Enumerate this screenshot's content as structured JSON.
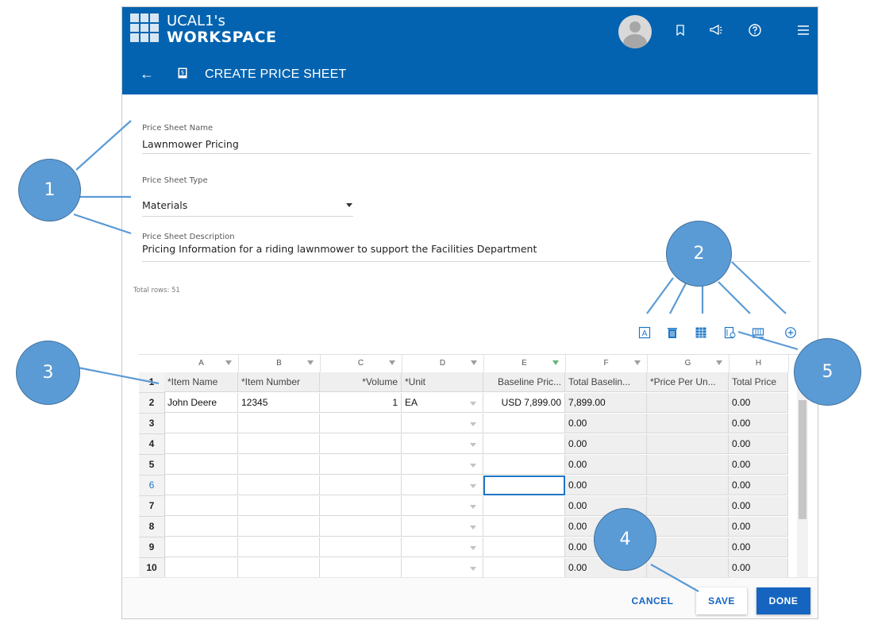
{
  "header": {
    "logo_line1": "UCAL1's",
    "logo_line2": "WORKSPACE",
    "page_title": "CREATE PRICE SHEET",
    "colors": {
      "header_blue": "#0363b0",
      "accent": "#1565c0",
      "callout": "#5b9bd5"
    },
    "icons": [
      "avatar",
      "bookmark-icon",
      "megaphone-icon",
      "help-icon",
      "menu-icon",
      "back-arrow-icon",
      "price-sheet-icon"
    ]
  },
  "form": {
    "name_label": "Price Sheet Name",
    "name_value": "Lawnmower Pricing",
    "type_label": "Price Sheet Type",
    "type_value": "Materials",
    "desc_label": "Price Sheet Description",
    "desc_value": "Pricing Information for a riding lawnmower to support the Facilities Department"
  },
  "total_rows": "Total rows: 51",
  "toolbar_icons": [
    "text-format-icon",
    "delete-icon",
    "columns-icon",
    "import-icon",
    "table-settings-icon",
    "add-icon"
  ],
  "grid": {
    "column_letters": [
      "A",
      "B",
      "C",
      "D",
      "E",
      "F",
      "G",
      "H"
    ],
    "header_row_number": "1",
    "headers": [
      "*Item Name",
      "*Item Number",
      "*Volume",
      "*Unit",
      "Baseline Pric...",
      "Total Baselin...",
      "*Price Per Un...",
      "Total Price"
    ],
    "rows": [
      {
        "num": "2",
        "cells": [
          "John Deere",
          "12345",
          "1",
          "EA",
          "USD 7,899.00",
          "7,899.00",
          "",
          "0.00"
        ]
      },
      {
        "num": "3",
        "cells": [
          "",
          "",
          "",
          "",
          "",
          "0.00",
          "",
          "0.00"
        ]
      },
      {
        "num": "4",
        "cells": [
          "",
          "",
          "",
          "",
          "",
          "0.00",
          "",
          "0.00"
        ]
      },
      {
        "num": "5",
        "cells": [
          "",
          "",
          "",
          "",
          "",
          "0.00",
          "",
          "0.00"
        ]
      },
      {
        "num": "6",
        "cells": [
          "",
          "",
          "",
          "",
          "",
          "0.00",
          "",
          "0.00"
        ]
      },
      {
        "num": "7",
        "cells": [
          "",
          "",
          "",
          "",
          "",
          "0.00",
          "",
          "0.00"
        ]
      },
      {
        "num": "8",
        "cells": [
          "",
          "",
          "",
          "",
          "",
          "0.00",
          "",
          "0.00"
        ]
      },
      {
        "num": "9",
        "cells": [
          "",
          "",
          "",
          "",
          "",
          "0.00",
          "",
          "0.00"
        ]
      },
      {
        "num": "10",
        "cells": [
          "",
          "",
          "",
          "",
          "",
          "0.00",
          "",
          "0.00"
        ]
      }
    ]
  },
  "footer": {
    "cancel_label": "CANCEL",
    "save_label": "SAVE",
    "done_label": "DONE"
  },
  "callouts": {
    "c1": "1",
    "c2": "2",
    "c3": "3",
    "c4": "4",
    "c5": "5"
  }
}
